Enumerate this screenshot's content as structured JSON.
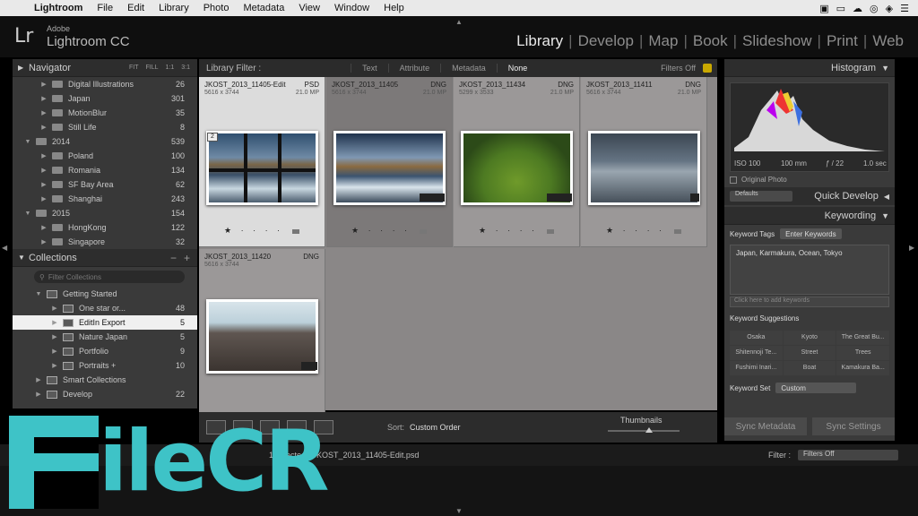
{
  "menubar": {
    "items": [
      "Lightroom",
      "File",
      "Edit",
      "Library",
      "Photo",
      "Metadata",
      "View",
      "Window",
      "Help"
    ]
  },
  "identity": {
    "adobe": "Adobe",
    "product": "Lightroom CC",
    "logo": "Lr"
  },
  "modules": [
    "Library",
    "Develop",
    "Map",
    "Book",
    "Slideshow",
    "Print",
    "Web"
  ],
  "navigator": {
    "title": "Navigator",
    "zoom": [
      "FIT",
      "FILL",
      "1:1",
      "3:1"
    ]
  },
  "folders": [
    {
      "label": "Digital Illustrations",
      "count": "26"
    },
    {
      "label": "Japan",
      "count": "301"
    },
    {
      "label": "MotionBlur",
      "count": "35"
    },
    {
      "label": "Still Life",
      "count": "8"
    },
    {
      "label": "2014",
      "count": "539"
    },
    {
      "label": "Poland",
      "count": "100"
    },
    {
      "label": "Romania",
      "count": "134"
    },
    {
      "label": "SF Bay Area",
      "count": "62"
    },
    {
      "label": "Shanghai",
      "count": "243"
    },
    {
      "label": "2015",
      "count": "154"
    },
    {
      "label": "HongKong",
      "count": "122"
    },
    {
      "label": "Singapore",
      "count": "32"
    }
  ],
  "collections": {
    "title": "Collections",
    "filter_placeholder": "Filter Collections",
    "items": [
      {
        "label": "Getting Started",
        "count": ""
      },
      {
        "label": "One star or...",
        "count": "48"
      },
      {
        "label": "EditIn Export",
        "count": "5"
      },
      {
        "label": "Nature Japan",
        "count": "5"
      },
      {
        "label": "Portfolio",
        "count": "9"
      },
      {
        "label": "Portraits +",
        "count": "10"
      },
      {
        "label": "Smart Collections",
        "count": ""
      },
      {
        "label": "Develop",
        "count": "22"
      }
    ]
  },
  "filterbar": {
    "title": "Library Filter :",
    "options": [
      "Text",
      "Attribute",
      "Metadata",
      "None"
    ],
    "filters_off": "Filters Off"
  },
  "grid": [
    {
      "name": "JKOST_2013_11405-Edit",
      "type": "PSD",
      "dims": "5616 x 3744",
      "mp": "21.0 MP",
      "badge": "2"
    },
    {
      "name": "JKOST_2013_11405",
      "type": "DNG",
      "dims": "5616 x 3744",
      "mp": "21.0 MP",
      "badge": ""
    },
    {
      "name": "JKOST_2013_11434",
      "type": "DNG",
      "dims": "5299 x 3533",
      "mp": "21.0 MP",
      "badge": ""
    },
    {
      "name": "JKOST_2013_11411",
      "type": "DNG",
      "dims": "5616 x 3744",
      "mp": "21.0 MP",
      "badge": ""
    },
    {
      "name": "JKOST_2013_11420",
      "type": "DNG",
      "dims": "5616 x 3744",
      "mp": "",
      "badge": ""
    }
  ],
  "toolbar": {
    "sort_label": "Sort:",
    "sort_value": "Custom Order",
    "thumbnails_label": "Thumbnails"
  },
  "histogram": {
    "title": "Histogram",
    "iso": "ISO 100",
    "focal": "100 mm",
    "aperture": "ƒ / 22",
    "shutter": "1.0 sec",
    "original_photo": "Original Photo"
  },
  "quick_develop": {
    "preset": "Defaults",
    "title": "Quick Develop"
  },
  "keywording": {
    "title": "Keywording",
    "tags_label": "Keyword Tags",
    "tags_mode": "Enter Keywords",
    "keywords": "Japan, Karmakura, Ocean, Tokyo",
    "add_placeholder": "Click here to add keywords",
    "suggestions_label": "Keyword Suggestions",
    "suggestions": [
      "Osaka",
      "Kyoto",
      "The Great Bu...",
      "Shitennoji Te...",
      "Street",
      "Trees",
      "Fushimi Inari...",
      "Boat",
      "Kamakura Ba..."
    ],
    "set_label": "Keyword Set",
    "set_value": "Custom"
  },
  "sync": {
    "metadata": "Sync Metadata",
    "settings": "Sync Settings"
  },
  "filmbar": {
    "path": "1 selected / JKOST_2013_11405-Edit.psd",
    "filter_label": "Filter :",
    "filter_value": "Filters Off"
  },
  "watermark": {
    "text": "ileCR"
  }
}
